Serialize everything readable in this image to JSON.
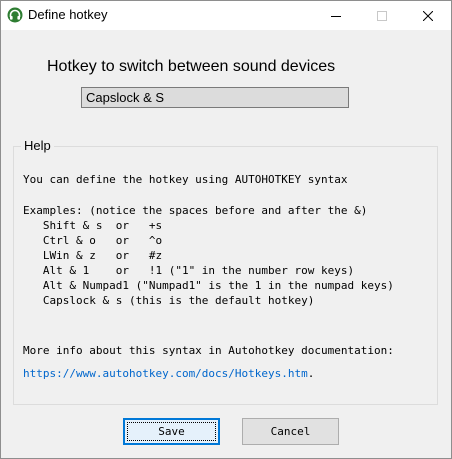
{
  "window": {
    "title": "Define hotkey",
    "accent_color": "#0078d7",
    "icon": "green-headphone-icon"
  },
  "titlebar": {
    "minimize_icon": "minimize-icon",
    "maximize_icon": "maximize-icon",
    "close_icon": "close-icon"
  },
  "main": {
    "heading": "Hotkey to switch between sound devices",
    "hotkey_value": "Capslock & S"
  },
  "help": {
    "legend": "Help",
    "intro": "You can define the hotkey using AUTOHOTKEY syntax",
    "examples_title": "Examples: (notice the spaces before and after the &)",
    "examples": [
      "   Shift & s  or   +s",
      "   Ctrl & o   or   ^o",
      "   LWin & z   or   #z",
      "   Alt & 1    or   !1 (\"1\" in the number row keys)",
      "   Alt & Numpad1 (\"Numpad1\" is the 1 in the numpad keys)",
      "   Capslock & s (this is the default hotkey)"
    ],
    "more_info": "More info about this syntax in Autohotkey documentation:",
    "link_text": "https://www.autohotkey.com/docs/Hotkeys.htm",
    "link_suffix": "."
  },
  "buttons": {
    "save_label": "Save",
    "cancel_label": "Cancel"
  }
}
